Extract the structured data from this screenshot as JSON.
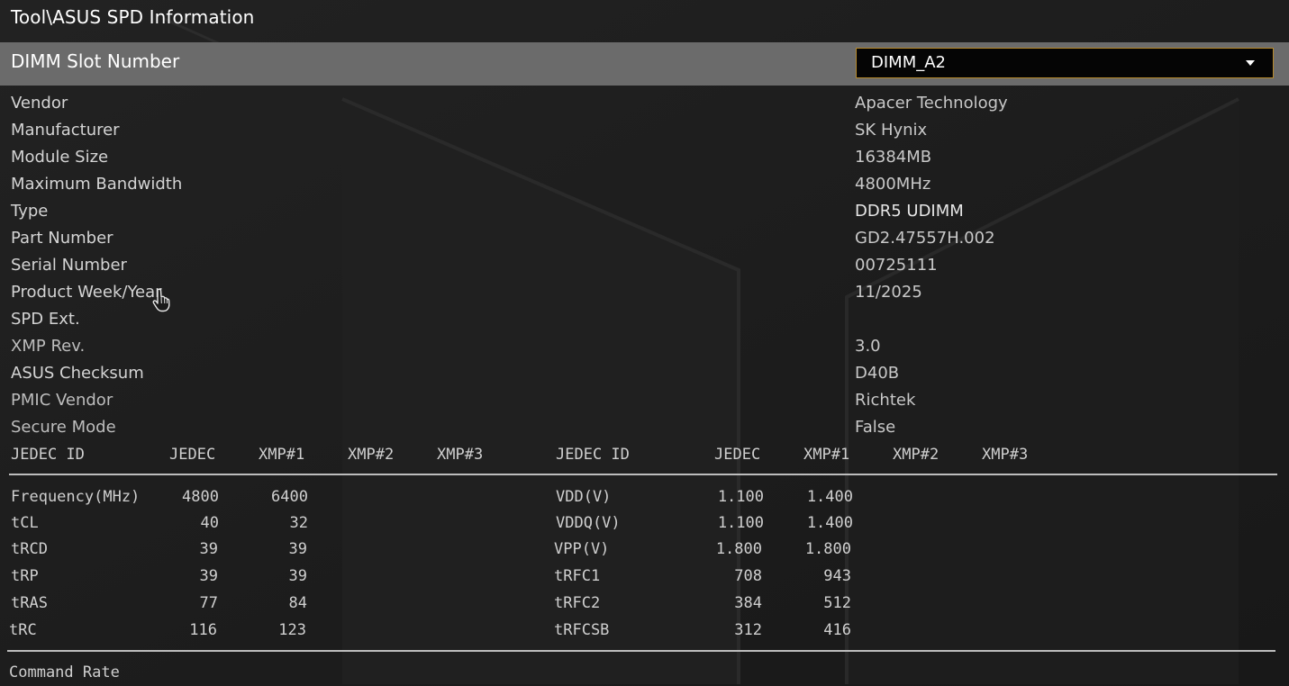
{
  "breadcrumb": "Tool\\ASUS SPD Information",
  "slot": {
    "label": "DIMM Slot Number",
    "selected": "DIMM_A2"
  },
  "info": [
    {
      "label": "Vendor",
      "value": "Apacer Technology"
    },
    {
      "label": "Manufacturer",
      "value": "SK Hynix"
    },
    {
      "label": "Module Size",
      "value": "16384MB"
    },
    {
      "label": "Maximum Bandwidth",
      "value": "4800MHz"
    },
    {
      "label": "Type",
      "value": "DDR5 UDIMM"
    },
    {
      "label": "Part Number",
      "value": "GD2.47557H.002"
    },
    {
      "label": "Serial Number",
      "value": "00725111"
    },
    {
      "label": "Product Week/Year",
      "value": "11/2025"
    },
    {
      "label": "SPD Ext.",
      "value": ""
    },
    {
      "label": "XMP Rev.",
      "value": "3.0"
    },
    {
      "label": "ASUS Checksum",
      "value": "D40B"
    },
    {
      "label": "PMIC Vendor",
      "value": "Richtek"
    },
    {
      "label": "Secure Mode",
      "value": "False"
    }
  ],
  "timing_table": {
    "headers": [
      "JEDEC ID",
      "JEDEC",
      "XMP#1",
      "XMP#2",
      "XMP#3"
    ],
    "left_rows": [
      {
        "label": "Frequency(MHz)",
        "jedec": "4800",
        "xmp1": "6400"
      },
      {
        "label": "tCL",
        "jedec": "40",
        "xmp1": "32"
      },
      {
        "label": "tRCD",
        "jedec": "39",
        "xmp1": "39"
      },
      {
        "label": "tRP",
        "jedec": "39",
        "xmp1": "39"
      },
      {
        "label": "tRAS",
        "jedec": "77",
        "xmp1": "84"
      },
      {
        "label": "tRC",
        "jedec": "116",
        "xmp1": "123"
      }
    ],
    "right_rows": [
      {
        "label": "VDD(V)",
        "jedec": "1.100",
        "xmp1": "1.400"
      },
      {
        "label": "VDDQ(V)",
        "jedec": "1.100",
        "xmp1": "1.400"
      },
      {
        "label": "VPP(V)",
        "jedec": "1.800",
        "xmp1": "1.800"
      },
      {
        "label": "tRFC1",
        "jedec": "708",
        "xmp1": "943"
      },
      {
        "label": "tRFC2",
        "jedec": "384",
        "xmp1": "512"
      },
      {
        "label": "tRFCSB",
        "jedec": "312",
        "xmp1": "416"
      }
    ]
  },
  "footer": {
    "label": "Command Rate"
  }
}
